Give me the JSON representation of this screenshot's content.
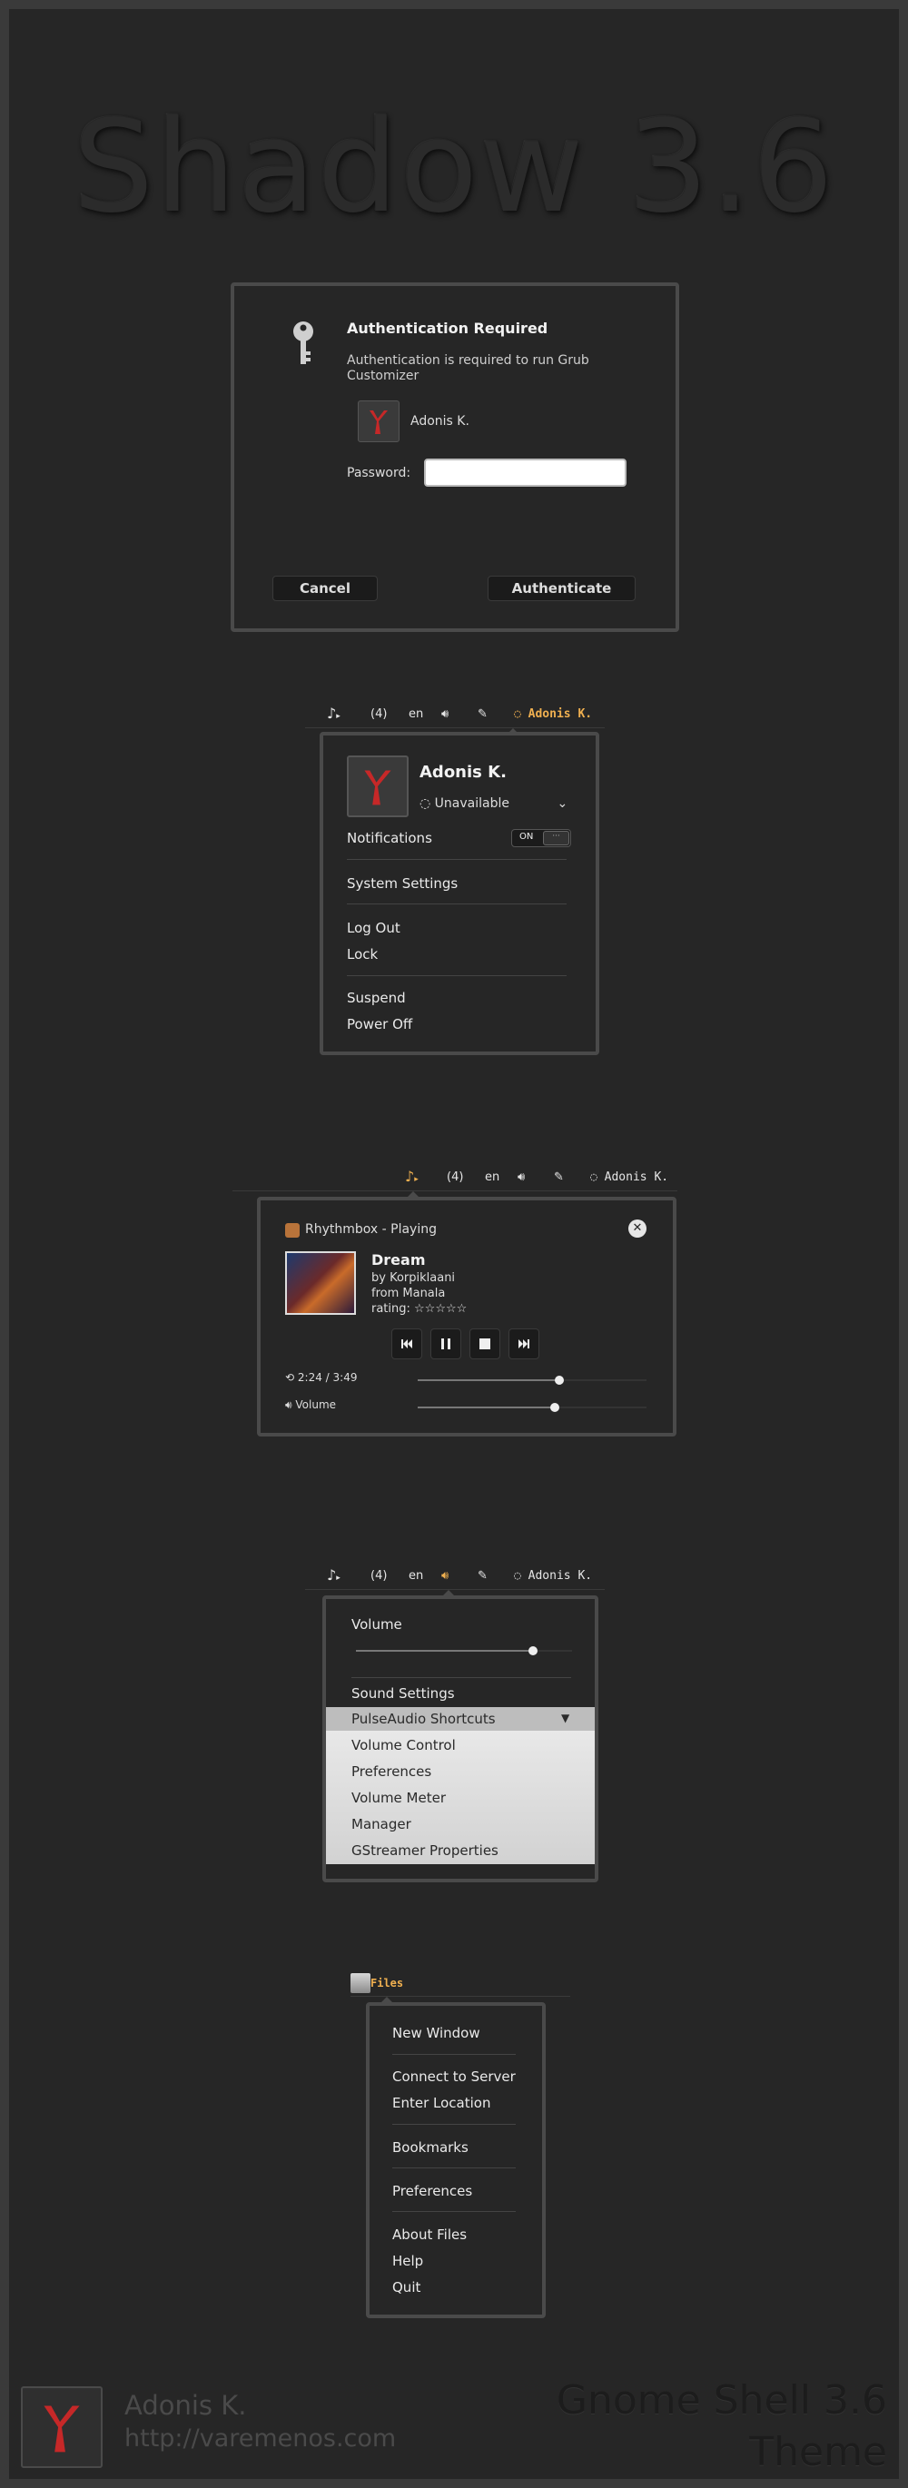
{
  "header": {
    "title": "Shadow 3.6"
  },
  "auth": {
    "title": "Authentication Required",
    "message_line1": "Authentication is required to run Grub",
    "message_line2": "Customizer",
    "user": "Adonis K.",
    "password_label": "Password:",
    "password_value": "",
    "cancel": "Cancel",
    "authenticate": "Authenticate"
  },
  "topbar": {
    "count": "(4)",
    "lang": "en",
    "user": "Adonis K."
  },
  "user_menu": {
    "name": "Adonis K.",
    "status": "Unavailable",
    "notifications": "Notifications",
    "toggle_on": "ON",
    "toggle_off": "···",
    "items": [
      "System Settings",
      "Log Out",
      "Lock",
      "Suspend",
      "Power Off"
    ]
  },
  "player": {
    "header": "Rhythmbox - Playing",
    "song": "Dream",
    "artist": "by Korpiklaani",
    "album": "from Manala",
    "rating": "rating: ☆☆☆☆☆",
    "time": "2:24 / 3:49",
    "progress": 0.62,
    "volume_label": "Volume",
    "volume": 0.6
  },
  "volume_menu": {
    "volume_label": "Volume",
    "level": 0.82,
    "sound_settings": "Sound Settings",
    "pulse_header": "PulseAudio Shortcuts",
    "pulse_items": [
      "Volume Control",
      "Preferences",
      "Volume Meter",
      "Manager",
      "GStreamer Properties"
    ]
  },
  "files": {
    "button": "Files",
    "items": [
      "New Window",
      "Connect to Server",
      "Enter Location",
      "Bookmarks",
      "Preferences",
      "About Files",
      "Help",
      "Quit"
    ]
  },
  "footer": {
    "name": "Adonis K.",
    "url": "http://varemenos.com",
    "theme_line1": "Gnome Shell 3.6",
    "theme_line2": "Theme"
  },
  "colors": {
    "accent": "#f0b050",
    "logo_red": "#c62828",
    "background": "#262626",
    "border": "#4a4a4a"
  }
}
